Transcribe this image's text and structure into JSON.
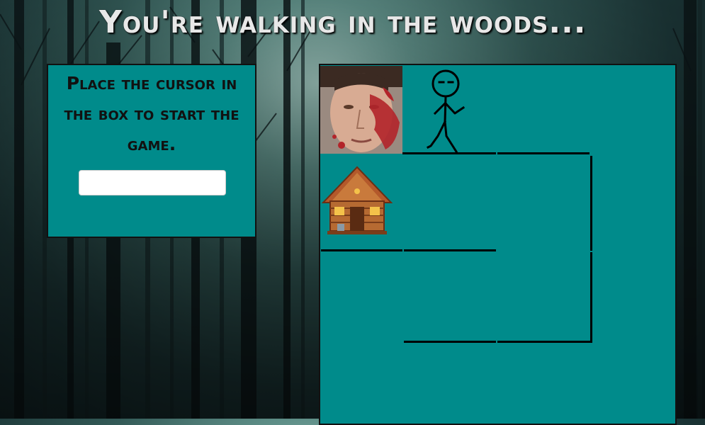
{
  "page": {
    "title": "You're walking in the woods..."
  },
  "start_panel": {
    "instruction": "Place the cursor in the box to start the game.",
    "input_value": ""
  },
  "maze": {
    "characters": [
      {
        "name": "bloody-face-icon",
        "cell_row": 0,
        "cell_col": 0
      },
      {
        "name": "stick-figure-icon",
        "cell_row": 0,
        "cell_col": 1
      },
      {
        "name": "cabin-icon",
        "cell_row": 1,
        "cell_col": 0
      }
    ]
  },
  "colors": {
    "panel_bg": "#008b8b",
    "title_text": "#e8e8e8",
    "border": "#111111",
    "blood": "#b3242a"
  }
}
